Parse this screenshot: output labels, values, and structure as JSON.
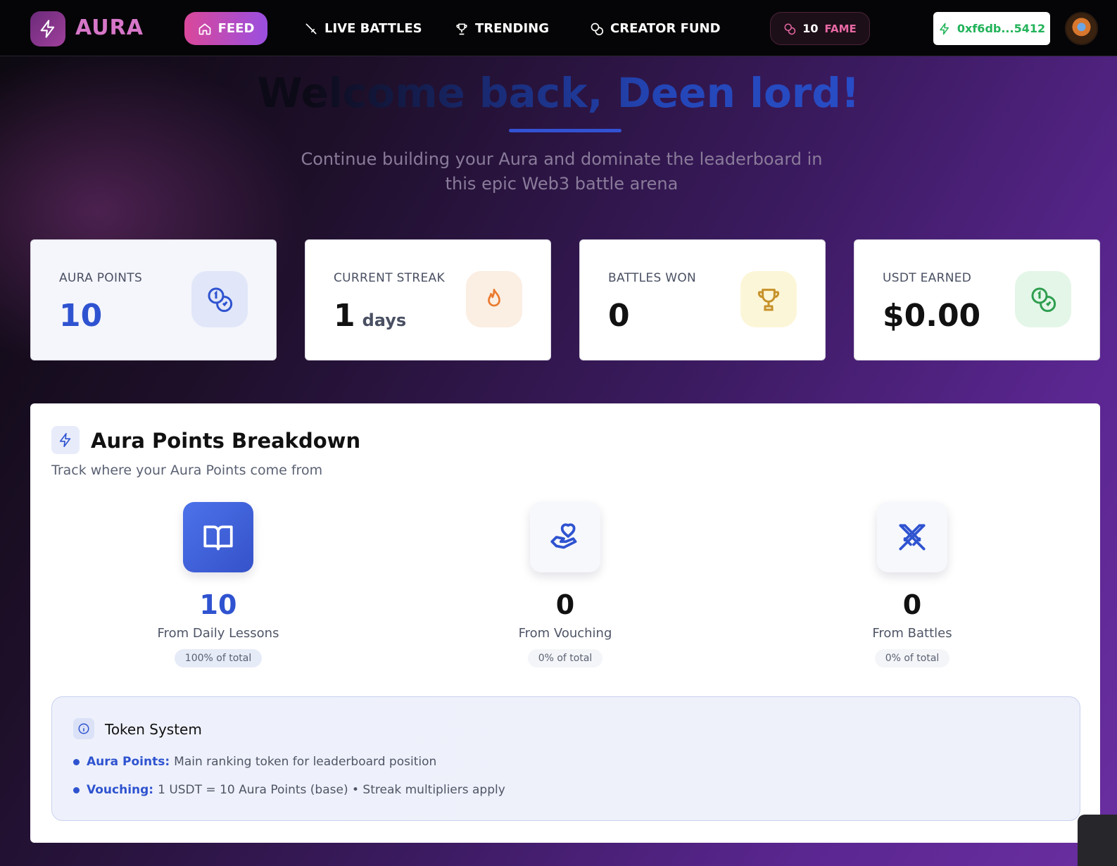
{
  "nav": {
    "logo": "AURA",
    "feed_label": "FEED",
    "live_battles_label": "LIVE BATTLES",
    "trending_label": "TRENDING",
    "creator_fund_label": "CREATOR FUND",
    "fame_value": "10",
    "fame_label": "FAME",
    "wallet": "0xf6db...5412"
  },
  "hero": {
    "title": "Welcome back, Deen  lord!",
    "subtitle": "Continue building your Aura and dominate the leaderboard in this epic Web3 battle arena"
  },
  "stats": [
    {
      "label": "AURA POINTS",
      "value": "10",
      "icon": "coins-icon",
      "color": "#2f53d0"
    },
    {
      "label": "CURRENT STREAK",
      "value": "1",
      "unit": "days",
      "icon": "flame-icon",
      "color": "#ea7a2e"
    },
    {
      "label": "BATTLES WON",
      "value": "0",
      "icon": "trophy-icon",
      "color": "#c7922a"
    },
    {
      "label": "USDT EARNED",
      "value": "$0.00",
      "icon": "coins-icon",
      "color": "#2f9e4f"
    }
  ],
  "breakdown": {
    "title": "Aura Points Breakdown",
    "subtitle": "Track where your Aura Points come from",
    "sources": [
      {
        "value": "10",
        "label": "From Daily Lessons",
        "percent": "100% of total",
        "icon": "book-icon"
      },
      {
        "value": "0",
        "label": "From Vouching",
        "percent": "0% of total",
        "icon": "hand-heart-icon"
      },
      {
        "value": "0",
        "label": "From Battles",
        "percent": "0% of total",
        "icon": "swords-icon"
      }
    ],
    "token_system": {
      "title": "Token System",
      "lines": [
        {
          "term": "Aura Points:",
          "text": "Main ranking token for leaderboard position"
        },
        {
          "term": "Vouching:",
          "text": "1 USDT = 10 Aura Points (base) • Streak multipliers apply"
        }
      ]
    }
  },
  "colors": {
    "accent": "#2f53d0",
    "brand": "#d676c8",
    "wallet": "#22b35a"
  }
}
